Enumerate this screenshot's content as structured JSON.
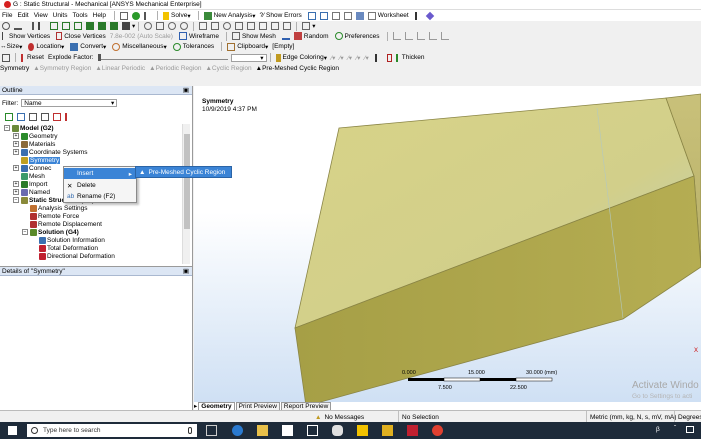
{
  "app": {
    "title": "G : Static Structural - Mechanical [ANSYS Mechanical Enterprise]"
  },
  "menu": [
    "File",
    "Edit",
    "View",
    "Units",
    "Tools",
    "Help"
  ],
  "toolbar1": {
    "solve_label": "Solve",
    "new_analysis_label": "New Analysis",
    "show_errors_label": "?⁄ Show Errors",
    "worksheet_label": "Worksheet"
  },
  "toolbar3": {
    "show_vertices_label": "Show Vertices",
    "close_vertices_label": "Close Vertices",
    "close_vertices_value": "7.8e-002 (Auto Scale)",
    "wireframe_label": "Wireframe",
    "show_mesh_label": "Show Mesh",
    "random_label": "Random",
    "preferences_label": "Preferences"
  },
  "toolbar4": {
    "size_label": "Size",
    "location_label": "Location",
    "convert_label": "Convert",
    "miscellaneous_label": "Miscellaneous",
    "tolerances_label": "Tolerances",
    "clipboard_label": "Clipboard",
    "empty_label": "[Empty]"
  },
  "toolbar5": {
    "reset_label": "Reset",
    "explode_factor_label": "Explode Factor:",
    "edge_coloring_label": "Edge Coloring",
    "thicken_label": "Thicken"
  },
  "context_toolbar": {
    "symmetry_label": "Symmetry",
    "symmetry_region_label": "Symmetry Region",
    "linear_periodic_label": "Linear Periodic",
    "periodic_region_label": "Periodic Region",
    "cyclic_region_label": "Cyclic Region",
    "pre_meshed_cyclic_label": "Pre-Meshed Cyclic Region"
  },
  "outline": {
    "header": "Outline",
    "filter_label": "Filter:",
    "filter_value": "Name",
    "tree": [
      {
        "label": "Model (G2)",
        "indent": 1,
        "bold": true,
        "exp": "−",
        "icon": "model-icon"
      },
      {
        "label": "Geometry",
        "indent": 2,
        "exp": "+",
        "icon": "geometry-icon"
      },
      {
        "label": "Materials",
        "indent": 2,
        "exp": "+",
        "icon": "materials-icon"
      },
      {
        "label": "Coordinate Systems",
        "indent": 2,
        "exp": "+",
        "icon": "coordinate-systems-icon"
      },
      {
        "label": "Symmetry",
        "indent": 2,
        "exp": "",
        "icon": "symmetry-icon",
        "selected": true
      },
      {
        "label": "Connec",
        "indent": 2,
        "exp": "+",
        "icon": "connections-icon"
      },
      {
        "label": "Mesh",
        "indent": 2,
        "exp": "",
        "icon": "mesh-icon"
      },
      {
        "label": "Import",
        "indent": 2,
        "exp": "+",
        "icon": "imported-load-icon"
      },
      {
        "label": "Named",
        "indent": 2,
        "exp": "+",
        "icon": "named-selections-icon"
      },
      {
        "label": "Static Structural (G3)",
        "indent": 2,
        "bold": true,
        "exp": "−",
        "icon": "static-structural-icon"
      },
      {
        "label": "Analysis Settings",
        "indent": 3,
        "exp": "",
        "icon": "analysis-settings-icon"
      },
      {
        "label": "Remote Force",
        "indent": 3,
        "exp": "",
        "icon": "remote-force-icon"
      },
      {
        "label": "Remote Displacement",
        "indent": 3,
        "exp": "",
        "icon": "remote-displacement-icon"
      },
      {
        "label": "Solution (G4)",
        "indent": 3,
        "bold": true,
        "exp": "−",
        "icon": "solution-icon"
      },
      {
        "label": "Solution Information",
        "indent": 4,
        "exp": "",
        "icon": "solution-information-icon"
      },
      {
        "label": "Total Deformation",
        "indent": 4,
        "exp": "",
        "icon": "total-deformation-icon"
      },
      {
        "label": "Directional Deformation",
        "indent": 4,
        "exp": "",
        "icon": "directional-deformation-icon"
      }
    ]
  },
  "context_menu": {
    "insert_label": "Insert",
    "delete_label": "Delete",
    "rename_label": "Rename (F2)",
    "submenu_label": "Pre-Meshed Cyclic Region"
  },
  "details": {
    "header": "Details of \"Symmetry\""
  },
  "viewport": {
    "title": "Symmetry",
    "date": "10/9/2019 4:37 PM",
    "scale": {
      "labels_top": [
        "0.000",
        "15.000",
        "30.000 (mm)"
      ],
      "labels_bottom": [
        "7.500",
        "22.500"
      ]
    },
    "watermark": "Activate Windo",
    "watermark2": "Go to Settings to acti",
    "right_marker": "X"
  },
  "viewport_tabs": [
    "Geometry",
    "Print Preview",
    "Report Preview"
  ],
  "statusbar": {
    "messages": "No Messages",
    "selection": "No Selection",
    "units": "Metric (mm, kg, N, s, mV, mA)",
    "degrees": "Degrees"
  },
  "taskbar": {
    "search_placeholder": "Type here to search",
    "clock_hint": "⏶"
  },
  "colors": {
    "part_face": "#d5cf80",
    "part_edge": "#8a8546",
    "selection_blue": "#3b84d6",
    "taskbar_bg": "#1e2b3a"
  }
}
